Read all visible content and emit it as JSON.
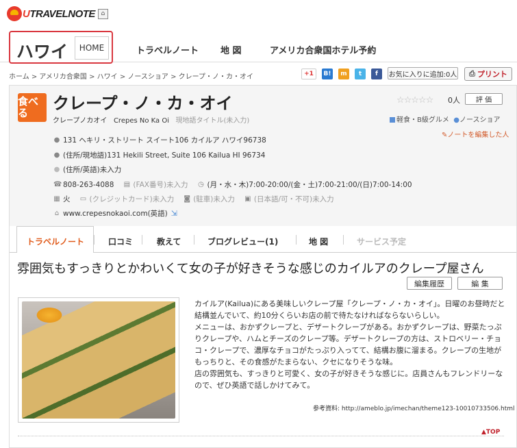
{
  "logo": {
    "text_u": "U",
    "text_rest": "TRAVELNOTE",
    "home_icon": "⌂"
  },
  "header": {
    "region": "ハワイ",
    "home_label": "HOME",
    "nav": [
      "トラベルノート",
      "地 図",
      "アメリカ合衆国ホテル予約"
    ]
  },
  "breadcrumb": "ホーム > アメリカ合衆国 > ハワイ > ノースショア > クレープ・ノ・カ・オイ",
  "share": {
    "gplus": "+1",
    "hatena": "B!",
    "mixi": "m",
    "twitter": "t",
    "facebook": "f"
  },
  "favorite_label": "お気に入りに追加:0人",
  "print_label": "プリント",
  "shop": {
    "badge": "食べる",
    "title": "クレープ・ノ・カ・オイ",
    "sub_kana": "クレープノカオイ",
    "sub_en": "Crepes No Ka Oi",
    "sub_local": "現地語タイトル(未入力)",
    "stars": "☆☆☆☆☆",
    "count": "0人",
    "eval_label": "評 価",
    "category1": "軽食・B級グルメ",
    "category2": "ノースショア",
    "edit_note": "ノートを編集した人",
    "address_ja": "131 ヘキリ・ストリート スイート106 カイルア ハワイ96738",
    "address_local": "(住所/現地語)131 Hekili Street, Suite 106 Kailua HI 96734",
    "address_en": "(住所/英語)未入力",
    "phone": "808-263-4088",
    "fax": "(FAX番号)未入力",
    "hours": "(月・水・木)7:00-20:00/(金・土)7:00-21:00/(日)7:00-14:00",
    "closed": "火",
    "credit": "(クレジットカード)未入力",
    "parking": "(駐車)未入力",
    "japanese": "(日本語/可・不可)未入力",
    "website": "www.crepesnokaoi.com(英語)"
  },
  "tabs": [
    "トラベルノート",
    "口コミ",
    "教えて",
    "ブログレビュー(1)",
    "地 図",
    "サービス予定"
  ],
  "article": {
    "headline": "雰囲気もすっきりとかわいくて女の子が好きそうな感じのカイルアのクレープ屋さん",
    "history_label": "編集履歴",
    "edit_label": "編 集",
    "p1": "カイルア(Kailua)にある美味しいクレープ屋「クレープ・ノ・カ・オイ」。日曜のお昼時だと結構並んでいて、約10分くらいお店の前で待たなければならないらしい。",
    "p2": "メニューは、おかずクレープと、デザートクレープがある。おかずクレープは、野菜たっぷりクレープや、ハムとチーズのクレープ等。デザートクレープの方は、ストロベリー・チョコ・クレープで、濃厚なチョコがたっぷり入ってて、結構お腹に溜まる。クレープの生地がもっちりと、その食感がたまらない、クセになりそうな味。",
    "p3": "店の雰囲気も、すっきりと可愛く、女の子が好きそうな感じに。店員さんもフレンドリーなので、ぜひ英語で話しかけてみて。",
    "ref": "参考資料: http://ameblo.jp/imechan/theme123-10010733506.html"
  },
  "top_link": "▲TOP"
}
